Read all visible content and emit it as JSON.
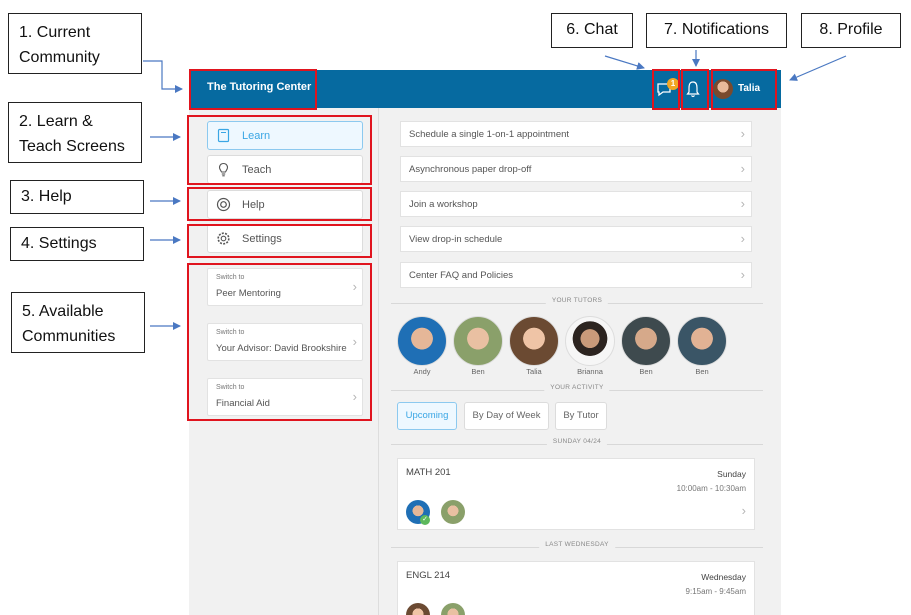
{
  "callouts": {
    "current_community": [
      "1. Current",
      "Community"
    ],
    "learn_teach": [
      "2. Learn &",
      "Teach Screens"
    ],
    "help": "3. Help",
    "settings": "4. Settings",
    "available_communities": [
      "5. Available",
      "Communities"
    ],
    "chat": "6. Chat",
    "notifications": "7. Notifications",
    "profile": "8. Profile"
  },
  "topbar": {
    "community_name": "The Tutoring Center",
    "chat_badge": "1",
    "profile_name": "Talia"
  },
  "sidebar": {
    "nav": [
      {
        "label": "Learn",
        "icon": "book-icon",
        "active": true
      },
      {
        "label": "Teach",
        "icon": "lightbulb-icon",
        "active": false
      },
      {
        "label": "Help",
        "icon": "lifebuoy-icon",
        "active": false
      },
      {
        "label": "Settings",
        "icon": "gear-icon",
        "active": false
      }
    ],
    "switch_prefix": "Switch to",
    "communities": [
      "Peer Mentoring",
      "Your Advisor: David Brookshire",
      "Financial Aid"
    ]
  },
  "main": {
    "actions": [
      "Schedule a single 1-on-1 appointment",
      "Asynchronous paper drop-off",
      "Join a workshop",
      "View drop-in schedule",
      "Center FAQ and Policies"
    ],
    "your_tutors_heading": "YOUR TUTORS",
    "tutors": [
      "Andy",
      "Ben",
      "Talia",
      "Brianna",
      "Ben",
      "Ben"
    ],
    "your_activity_heading": "YOUR ACTIVITY",
    "filters": [
      "Upcoming",
      "By Day of Week",
      "By Tutor"
    ],
    "date_heading_1": "SUNDAY 04/24",
    "date_heading_2": "LAST WEDNESDAY",
    "sessions": [
      {
        "course": "MATH 201",
        "day": "Sunday",
        "time": "10:00am - 10:30am"
      },
      {
        "course": "ENGL 214",
        "day": "Wednesday",
        "time": "9:15am - 9:45am"
      }
    ]
  },
  "colors": {
    "topbar": "#066aa0",
    "highlight": "#e0141e",
    "accent": "#3aa6e4",
    "badge": "#f2a623"
  }
}
